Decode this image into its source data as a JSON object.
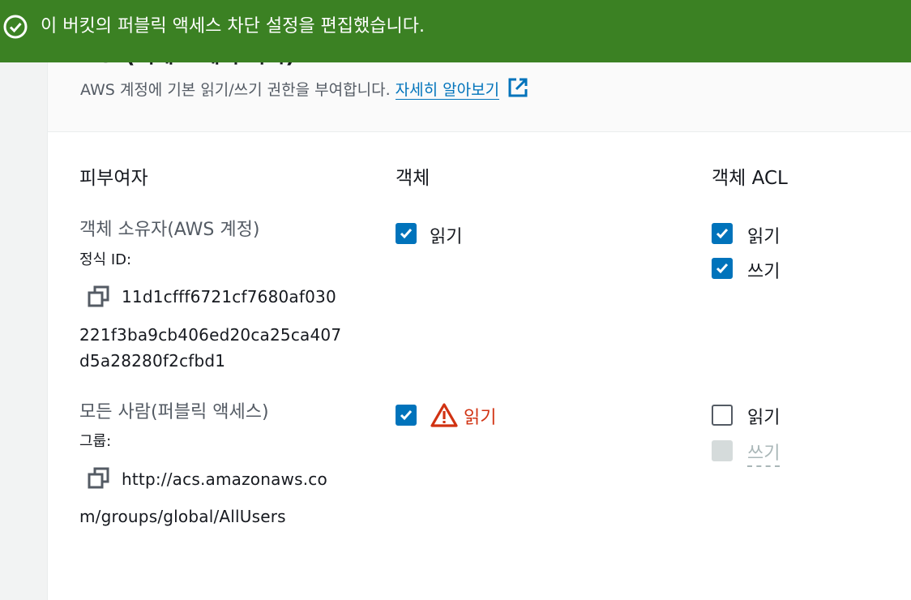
{
  "flash": {
    "message": "이 버킷의 퍼블릭 액세스 차단 설정을 편집했습니다.",
    "icon": "check-circle-icon",
    "color": "#3b8123"
  },
  "section": {
    "title": "ACL(액세스 제어 목록)",
    "description": "AWS 계정에 기본 읽기/쓰기 권한을 부여합니다.",
    "learn_more": "자세히 알아보기"
  },
  "columns": {
    "grantee": "피부여자",
    "objects": "객체",
    "object_acl": "객체 ACL"
  },
  "rows": [
    {
      "grantee": "객체 소유자(AWS 계정)",
      "id_label": "정식 ID:",
      "id_lines": [
        "11d1cfff6721cf7680af030",
        "221f3ba9cb406ed20ca25ca407",
        "d5a28280f2cfbd1"
      ],
      "objects": {
        "read_label": "읽기",
        "read": true
      },
      "acl": {
        "read_label": "읽기",
        "read": true,
        "write_label": "쓰기",
        "write": true
      }
    },
    {
      "grantee": "모든 사람(퍼블릭 액세스)",
      "id_label": "그룹:",
      "id_lines": [
        "http://acs.amazonaws.co",
        "m/groups/global/AllUsers"
      ],
      "objects": {
        "read_label": "읽기",
        "read": true,
        "warning": true
      },
      "acl": {
        "read_label": "읽기",
        "read": false,
        "write_label": "쓰기",
        "write": false,
        "write_disabled": true
      }
    }
  ],
  "colors": {
    "accent": "#0073bb",
    "warning": "#d13212",
    "success": "#3b8123"
  }
}
